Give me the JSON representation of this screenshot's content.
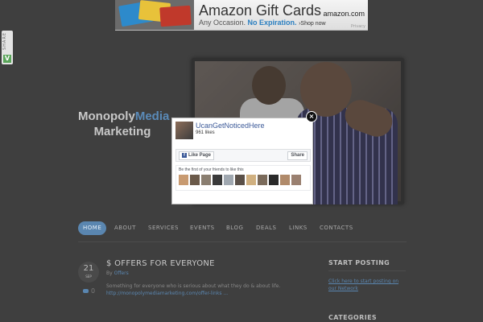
{
  "ad": {
    "headline": "Amazon Gift Cards",
    "tagline_prefix": "Any Occasion.",
    "tagline_highlight": "No Expiration.",
    "shop": "›Shop now",
    "brand": "amazon.com",
    "legal": "Privacy"
  },
  "share_tab": {
    "label": "SHARE",
    "icon": "V"
  },
  "logo": {
    "part1": "Monopoly",
    "part2": "Media",
    "line2": "Marketing"
  },
  "nav": {
    "items": [
      "HOME",
      "ABOUT",
      "SERVICES",
      "EVENTS",
      "BLOG",
      "DEALS",
      "LINKS",
      "CONTACTS"
    ],
    "active_index": 0
  },
  "post": {
    "day": "21",
    "month": "SEP",
    "title": "$ OFFERS FOR EVERYONE",
    "by_prefix": "By",
    "category": "Offers",
    "comments": "0",
    "excerpt": "Something for everyone who is serious about what they do & about life.",
    "link": "http://monopolymediamarketing.com/offer-links ..."
  },
  "sidebar": {
    "start_title": "START POSTING",
    "start_link": "Click here to start posting on our Network",
    "categories_title": "CATEGORIES"
  },
  "fb_popup": {
    "page_name": "UcanGetNoticedHere",
    "likes": "961 likes",
    "like_button": "Like Page",
    "share_button": "Share",
    "friends_text": "Be the first of your friends to like this",
    "face_colors": [
      "#c89a70",
      "#6b5a4a",
      "#8a7e70",
      "#3a3a3a",
      "#a0a8b0",
      "#5a5048",
      "#d0b080",
      "#7a6a5a",
      "#2a2a2a",
      "#b08a6a",
      "#9a8070"
    ],
    "close": "×"
  }
}
